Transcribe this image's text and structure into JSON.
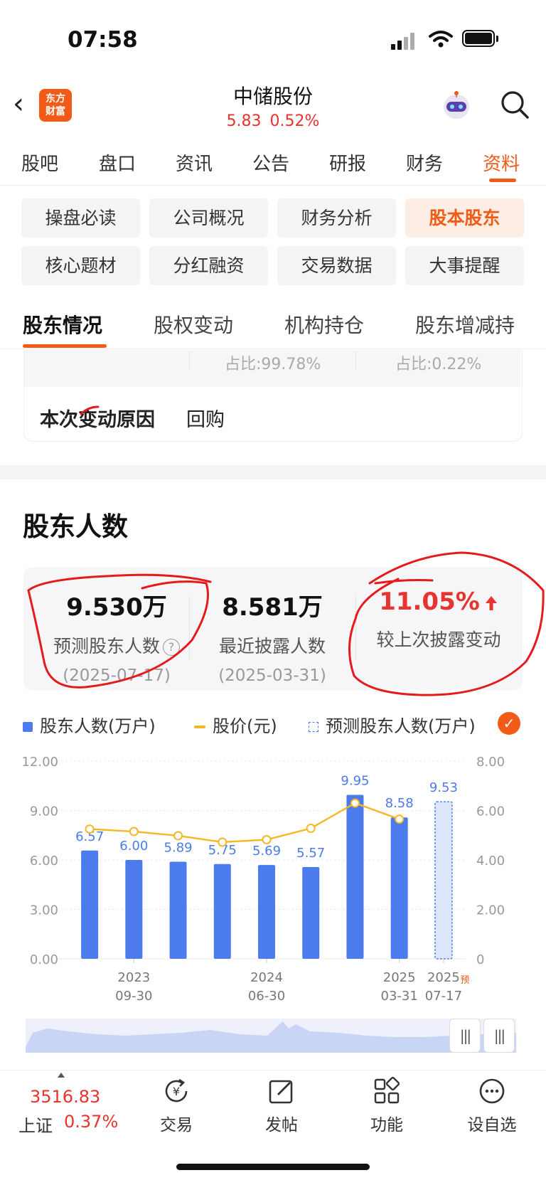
{
  "status_bar": {
    "time": "07:58"
  },
  "header": {
    "logo_text": "东方财富",
    "title": "中储股份",
    "price": "5.83",
    "change_pct": "0.52%"
  },
  "main_tabs": [
    {
      "label": "股吧"
    },
    {
      "label": "盘口"
    },
    {
      "label": "资讯"
    },
    {
      "label": "公告"
    },
    {
      "label": "研报"
    },
    {
      "label": "财务"
    },
    {
      "label": "资料",
      "active": true
    }
  ],
  "pills": [
    {
      "label": "操盘必读"
    },
    {
      "label": "公司概况"
    },
    {
      "label": "财务分析"
    },
    {
      "label": "股本股东",
      "active": true
    },
    {
      "label": "核心题材"
    },
    {
      "label": "分红融资"
    },
    {
      "label": "交易数据"
    },
    {
      "label": "大事提醒"
    }
  ],
  "sub_tabs": [
    {
      "label": "股东情况",
      "active": true
    },
    {
      "label": "股权变动"
    },
    {
      "label": "机构持仓"
    },
    {
      "label": "股东增减持"
    }
  ],
  "prev_card": {
    "ratio_a": "占比:99.78%",
    "ratio_b": "占比:0.22%",
    "reason_label": "本次变动原因",
    "reason_value": "回购"
  },
  "section": {
    "title": "股东人数"
  },
  "stats": [
    {
      "value": "9.530万",
      "label": "预测股东人数",
      "help_icon": "question-icon",
      "date": "(2025-07-17)"
    },
    {
      "value": "8.581万",
      "label": "最近披露人数",
      "date": "(2025-03-31)"
    },
    {
      "value": "11.05%",
      "label": "较上次披露变动",
      "trend_icon": "arrow-up-icon",
      "color": "#e8332e"
    }
  ],
  "legend": {
    "bars": "股东人数(万户)",
    "line": "股价(元)",
    "forecast": "预测股东人数(万户)"
  },
  "colors": {
    "accent": "#f25a18",
    "bar": "#4b7bec",
    "line": "#f5b724",
    "up": "#e8332e",
    "annotation": "#e51b1b"
  },
  "chart_data": {
    "type": "bar",
    "series": [
      {
        "name": "股东人数(万户)",
        "type": "bar",
        "values": [
          6.57,
          6.0,
          5.89,
          5.75,
          5.69,
          5.57,
          9.95,
          8.58,
          9.53
        ],
        "forecast_index": 8
      },
      {
        "name": "股价(元)",
        "type": "line",
        "values": [
          5.25,
          5.15,
          4.98,
          4.72,
          4.82,
          5.28,
          6.3,
          5.65
        ]
      }
    ],
    "y_left": {
      "ticks": [
        "12.00",
        "9.00",
        "6.00",
        "3.00",
        "0.00"
      ],
      "min": 0,
      "max": 12
    },
    "y_right": {
      "ticks": [
        "8.00",
        "6.00",
        "4.00",
        "2.00",
        "0"
      ],
      "min": 0,
      "max": 8
    },
    "x_labels": [
      {
        "index": 1,
        "line1": "2023",
        "line2": "09-30"
      },
      {
        "index": 4,
        "line1": "2024",
        "line2": "06-30"
      },
      {
        "index": 7,
        "line1": "2025",
        "line2": "03-31"
      },
      {
        "index": 8,
        "line1": "2025",
        "line2": "07-17"
      }
    ],
    "forecast_tag": "预",
    "grid": true
  },
  "bottom_nav": {
    "index_value": "3516.83",
    "index_name": "上证",
    "index_change": "0.37%",
    "items": [
      {
        "label": "交易",
        "icon": "trade-icon"
      },
      {
        "label": "发帖",
        "icon": "post-icon"
      },
      {
        "label": "功能",
        "icon": "grid-icon"
      },
      {
        "label": "设自选",
        "icon": "more-icon"
      }
    ]
  }
}
